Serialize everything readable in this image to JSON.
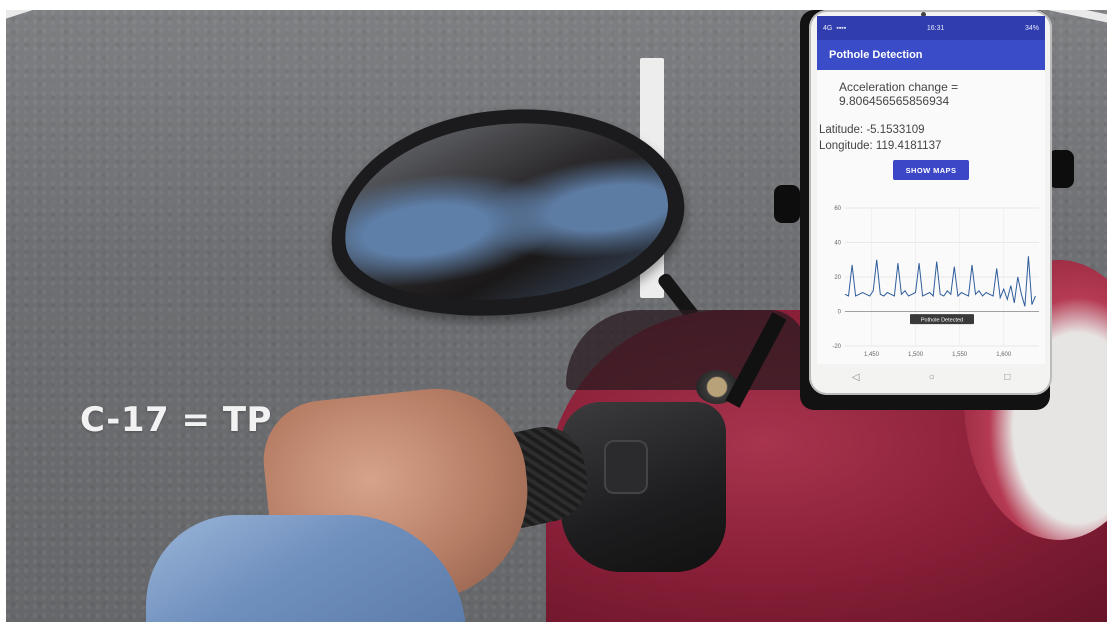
{
  "caption": "C-17 = TP",
  "phone": {
    "status": {
      "signal": "4G",
      "time": "16:31",
      "battery": "34%"
    },
    "app_title": "Pothole Detection",
    "acceleration_label": "Acceleration change =",
    "acceleration_value": "9.806456565856934",
    "latitude": "Latitude: -5.1533109",
    "longitude": "Longitude: 119.4181137",
    "show_maps_label": "SHOW MAPS",
    "nav": {
      "back": "◁",
      "home": "○",
      "recent": "□"
    }
  },
  "chart_data": {
    "type": "line",
    "title": "",
    "xlabel": "",
    "ylabel": "",
    "y_ticks": [
      "60",
      "40",
      "20",
      "0",
      "-20"
    ],
    "x_ticks": [
      "1,450",
      "1,500",
      "1,550",
      "1,600"
    ],
    "ylim": [
      -20,
      60
    ],
    "xlim": [
      1420,
      1640
    ],
    "marker_label": "Pothole Detected",
    "color": "#2f5d9a",
    "series": [
      {
        "x": [
          1420,
          1424,
          1428,
          1432,
          1436,
          1440,
          1444,
          1448,
          1452,
          1456,
          1460,
          1464,
          1468,
          1472,
          1476,
          1480,
          1484,
          1488,
          1492,
          1496,
          1500,
          1504,
          1508,
          1512,
          1516,
          1520,
          1524,
          1528,
          1532,
          1536,
          1540,
          1544,
          1548,
          1552,
          1556,
          1560,
          1564,
          1568,
          1572,
          1576,
          1580,
          1584,
          1588,
          1592,
          1596,
          1600,
          1604,
          1608,
          1612,
          1616,
          1620,
          1624,
          1628,
          1632,
          1636
        ],
        "y": [
          10,
          9,
          27,
          9,
          10,
          11,
          10,
          9,
          12,
          30,
          10,
          9,
          11,
          10,
          9,
          28,
          10,
          12,
          9,
          10,
          11,
          28,
          9,
          10,
          11,
          9,
          29,
          10,
          9,
          12,
          10,
          26,
          9,
          11,
          10,
          9,
          27,
          10,
          12,
          9,
          11,
          10,
          9,
          25,
          8,
          13,
          7,
          15,
          5,
          20,
          10,
          3,
          32,
          4,
          9
        ]
      }
    ]
  }
}
